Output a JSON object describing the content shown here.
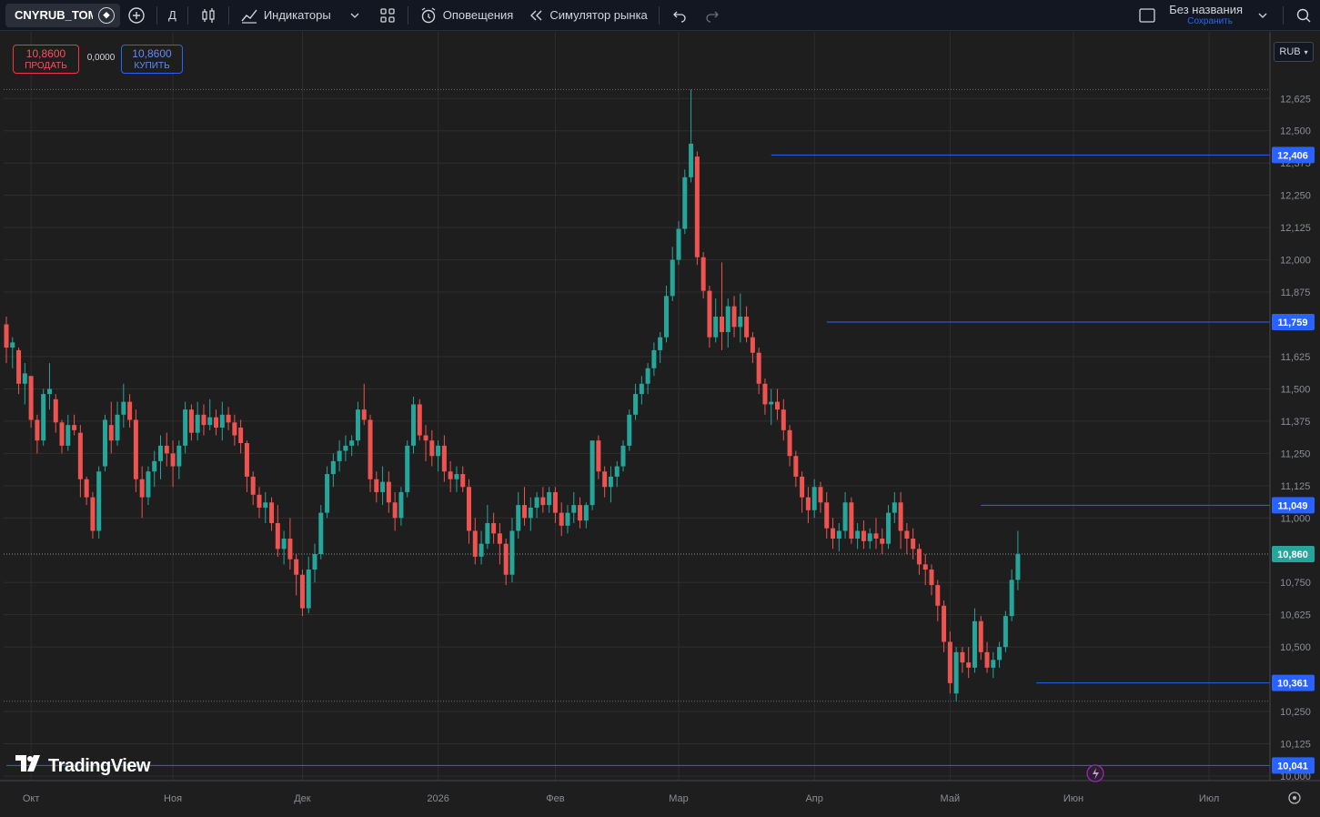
{
  "toolbar": {
    "symbol": "CNYRUB_TOM",
    "interval": "Д",
    "indicators_label": "Индикаторы",
    "alerts_label": "Оповещения",
    "replay_label": "Симулятор рынка",
    "layout_name": "Без названия",
    "layout_save": "Сохранить"
  },
  "trade": {
    "sell_price": "10,8600",
    "sell_label": "ПРОДАТЬ",
    "spread": "0,0000",
    "buy_price": "10,8600",
    "buy_label": "КУПИТЬ"
  },
  "currency": "RUB",
  "logo_text": "TradingView",
  "colors": {
    "up": "#26a69a",
    "down": "#ef5350",
    "hline": "#2962ff",
    "grid": "#2e2e2e",
    "background": "#1e1e1e"
  },
  "chart_data": {
    "type": "candlestick",
    "y_axis": {
      "min": 10.0,
      "max": 12.7,
      "ticks": [
        "12,625",
        "12,500",
        "12,375",
        "12,250",
        "12,125",
        "12,000",
        "11,875",
        "11,625",
        "11,500",
        "11,375",
        "11,250",
        "11,125",
        "11,000",
        "10,750",
        "10,625",
        "10,500",
        "10,250",
        "10,125",
        "10,000"
      ]
    },
    "x_axis": {
      "ticks": [
        {
          "label": "Окт",
          "index": 4
        },
        {
          "label": "Ноя",
          "index": 27
        },
        {
          "label": "Дек",
          "index": 48
        },
        {
          "label": "2026",
          "index": 70
        },
        {
          "label": "Фев",
          "index": 89
        },
        {
          "label": "Мар",
          "index": 109
        },
        {
          "label": "Апр",
          "index": 131
        },
        {
          "label": "Май",
          "index": 153
        },
        {
          "label": "Июн",
          "index": 173
        },
        {
          "label": "Июл",
          "index": 195
        }
      ]
    },
    "last_price": 10.86,
    "last_price_label": "10,860",
    "horizontal_lines": [
      {
        "value": 12.406,
        "label": "12,406",
        "start_index": 124
      },
      {
        "value": 11.759,
        "label": "11,759",
        "start_index": 133
      },
      {
        "value": 11.049,
        "label": "11,049",
        "start_index": 158
      },
      {
        "value": 10.361,
        "label": "10,361",
        "start_index": 167
      },
      {
        "value": 10.041,
        "label": "10,041",
        "start_index": 0
      }
    ],
    "high_dotted": 12.66,
    "low_dotted": 10.29,
    "candles": [
      [
        11.75,
        11.78,
        11.6,
        11.66
      ],
      [
        11.66,
        11.7,
        11.58,
        11.68
      ],
      [
        11.65,
        11.66,
        11.48,
        11.52
      ],
      [
        11.52,
        11.6,
        11.44,
        11.56
      ],
      [
        11.55,
        11.55,
        11.35,
        11.38
      ],
      [
        11.38,
        11.4,
        11.25,
        11.3
      ],
      [
        11.3,
        11.5,
        11.28,
        11.48
      ],
      [
        11.48,
        11.6,
        11.42,
        11.5
      ],
      [
        11.46,
        11.48,
        11.33,
        11.37
      ],
      [
        11.37,
        11.38,
        11.25,
        11.28
      ],
      [
        11.28,
        11.4,
        11.26,
        11.36
      ],
      [
        11.36,
        11.4,
        11.32,
        11.34
      ],
      [
        11.33,
        11.36,
        11.08,
        11.15
      ],
      [
        11.15,
        11.16,
        11.05,
        11.08
      ],
      [
        11.08,
        11.1,
        10.92,
        10.95
      ],
      [
        10.95,
        11.2,
        10.92,
        11.18
      ],
      [
        11.2,
        11.4,
        11.18,
        11.38
      ],
      [
        11.36,
        11.45,
        11.25,
        11.3
      ],
      [
        11.3,
        11.45,
        11.28,
        11.4
      ],
      [
        11.4,
        11.52,
        11.35,
        11.45
      ],
      [
        11.45,
        11.48,
        11.35,
        11.38
      ],
      [
        11.38,
        11.42,
        11.1,
        11.15
      ],
      [
        11.15,
        11.2,
        11.0,
        11.08
      ],
      [
        11.08,
        11.2,
        11.05,
        11.18
      ],
      [
        11.18,
        11.26,
        11.12,
        11.22
      ],
      [
        11.22,
        11.32,
        11.15,
        11.28
      ],
      [
        11.28,
        11.33,
        11.2,
        11.25
      ],
      [
        11.25,
        11.3,
        11.12,
        11.2
      ],
      [
        11.2,
        11.3,
        11.15,
        11.28
      ],
      [
        11.28,
        11.45,
        11.25,
        11.42
      ],
      [
        11.42,
        11.44,
        11.3,
        11.33
      ],
      [
        11.33,
        11.45,
        11.3,
        11.4
      ],
      [
        11.4,
        11.44,
        11.32,
        11.36
      ],
      [
        11.36,
        11.46,
        11.34,
        11.39
      ],
      [
        11.39,
        11.42,
        11.32,
        11.35
      ],
      [
        11.35,
        11.45,
        11.3,
        11.4
      ],
      [
        11.4,
        11.43,
        11.34,
        11.37
      ],
      [
        11.37,
        11.4,
        11.28,
        11.32
      ],
      [
        11.35,
        11.38,
        11.25,
        11.29
      ],
      [
        11.29,
        11.3,
        11.1,
        11.16
      ],
      [
        11.16,
        11.18,
        11.05,
        11.09
      ],
      [
        11.09,
        11.12,
        11.0,
        11.04
      ],
      [
        11.04,
        11.1,
        10.98,
        11.06
      ],
      [
        11.06,
        11.08,
        10.95,
        10.98
      ],
      [
        10.98,
        11.05,
        10.85,
        10.88
      ],
      [
        10.88,
        10.95,
        10.82,
        10.92
      ],
      [
        10.92,
        11.0,
        10.8,
        10.84
      ],
      [
        10.84,
        10.86,
        10.7,
        10.78
      ],
      [
        10.78,
        10.8,
        10.62,
        10.65
      ],
      [
        10.65,
        10.85,
        10.63,
        10.8
      ],
      [
        10.8,
        10.9,
        10.75,
        10.86
      ],
      [
        10.86,
        11.05,
        10.84,
        11.02
      ],
      [
        11.02,
        11.2,
        11.0,
        11.17
      ],
      [
        11.17,
        11.25,
        11.12,
        11.22
      ],
      [
        11.22,
        11.3,
        11.18,
        11.26
      ],
      [
        11.26,
        11.32,
        11.22,
        11.28
      ],
      [
        11.28,
        11.32,
        11.24,
        11.3
      ],
      [
        11.3,
        11.45,
        11.28,
        11.42
      ],
      [
        11.42,
        11.52,
        11.36,
        11.38
      ],
      [
        11.38,
        11.4,
        11.1,
        11.15
      ],
      [
        11.15,
        11.18,
        11.06,
        11.1
      ],
      [
        11.1,
        11.2,
        11.05,
        11.14
      ],
      [
        11.14,
        11.18,
        11.02,
        11.06
      ],
      [
        11.06,
        11.1,
        10.95,
        11.0
      ],
      [
        11.0,
        11.12,
        10.97,
        11.1
      ],
      [
        11.1,
        11.3,
        11.08,
        11.28
      ],
      [
        11.28,
        11.47,
        11.25,
        11.44
      ],
      [
        11.44,
        11.46,
        11.3,
        11.32
      ],
      [
        11.32,
        11.36,
        11.22,
        11.3
      ],
      [
        11.3,
        11.34,
        11.2,
        11.24
      ],
      [
        11.24,
        11.3,
        11.18,
        11.28
      ],
      [
        11.28,
        11.32,
        11.14,
        11.18
      ],
      [
        11.18,
        11.22,
        11.1,
        11.15
      ],
      [
        11.15,
        11.2,
        11.1,
        11.17
      ],
      [
        11.17,
        11.2,
        11.1,
        11.12
      ],
      [
        11.12,
        11.15,
        10.9,
        10.95
      ],
      [
        10.95,
        11.0,
        10.82,
        10.85
      ],
      [
        10.85,
        10.95,
        10.82,
        10.9
      ],
      [
        10.9,
        11.05,
        10.88,
        10.98
      ],
      [
        10.98,
        11.02,
        10.9,
        10.94
      ],
      [
        10.94,
        10.98,
        10.82,
        10.9
      ],
      [
        10.9,
        10.92,
        10.74,
        10.78
      ],
      [
        10.78,
        11.0,
        10.75,
        10.95
      ],
      [
        10.95,
        11.1,
        10.92,
        11.05
      ],
      [
        11.05,
        11.12,
        10.97,
        11.0
      ],
      [
        11.0,
        11.08,
        10.95,
        11.04
      ],
      [
        11.04,
        11.1,
        11.0,
        11.08
      ],
      [
        11.08,
        11.12,
        11.02,
        11.05
      ],
      [
        11.05,
        11.12,
        11.02,
        11.1
      ],
      [
        11.1,
        11.12,
        10.98,
        11.02
      ],
      [
        11.02,
        11.06,
        10.93,
        10.97
      ],
      [
        10.97,
        11.05,
        10.94,
        11.02
      ],
      [
        11.02,
        11.1,
        10.98,
        11.05
      ],
      [
        11.05,
        11.08,
        10.96,
        10.99
      ],
      [
        10.99,
        11.06,
        10.96,
        11.05
      ],
      [
        11.05,
        11.22,
        11.03,
        11.3
      ],
      [
        11.3,
        11.32,
        11.15,
        11.18
      ],
      [
        11.18,
        11.2,
        11.08,
        11.12
      ],
      [
        11.12,
        11.2,
        11.06,
        11.16
      ],
      [
        11.16,
        11.22,
        11.12,
        11.2
      ],
      [
        11.2,
        11.3,
        11.18,
        11.28
      ],
      [
        11.28,
        11.42,
        11.26,
        11.4
      ],
      [
        11.4,
        11.52,
        11.38,
        11.48
      ],
      [
        11.48,
        11.55,
        11.44,
        11.52
      ],
      [
        11.52,
        11.6,
        11.48,
        11.58
      ],
      [
        11.58,
        11.68,
        11.55,
        11.65
      ],
      [
        11.65,
        11.72,
        11.6,
        11.7
      ],
      [
        11.7,
        11.9,
        11.68,
        11.86
      ],
      [
        11.86,
        12.05,
        11.84,
        12.0
      ],
      [
        12.0,
        12.15,
        11.98,
        12.12
      ],
      [
        12.12,
        12.35,
        12.1,
        12.32
      ],
      [
        12.32,
        12.66,
        12.3,
        12.45
      ],
      [
        12.4,
        12.42,
        11.98,
        12.01
      ],
      [
        12.01,
        12.03,
        11.85,
        11.88
      ],
      [
        11.88,
        11.9,
        11.66,
        11.7
      ],
      [
        11.7,
        11.85,
        11.68,
        11.78
      ],
      [
        11.78,
        11.99,
        11.65,
        11.72
      ],
      [
        11.72,
        11.85,
        11.66,
        11.82
      ],
      [
        11.82,
        11.86,
        11.7,
        11.74
      ],
      [
        11.74,
        11.87,
        11.68,
        11.78
      ],
      [
        11.78,
        11.82,
        11.68,
        11.7
      ],
      [
        11.7,
        11.72,
        11.6,
        11.64
      ],
      [
        11.64,
        11.66,
        11.48,
        11.52
      ],
      [
        11.52,
        11.54,
        11.4,
        11.44
      ],
      [
        11.44,
        11.5,
        11.36,
        11.45
      ],
      [
        11.45,
        11.5,
        11.38,
        11.42
      ],
      [
        11.42,
        11.46,
        11.3,
        11.34
      ],
      [
        11.34,
        11.36,
        11.2,
        11.24
      ],
      [
        11.24,
        11.26,
        11.12,
        11.16
      ],
      [
        11.16,
        11.18,
        11.02,
        11.08
      ],
      [
        11.08,
        11.12,
        10.98,
        11.03
      ],
      [
        11.03,
        11.15,
        11.0,
        11.12
      ],
      [
        11.12,
        11.14,
        11.02,
        11.06
      ],
      [
        11.06,
        11.1,
        10.92,
        10.96
      ],
      [
        10.96,
        11.0,
        10.88,
        10.92
      ],
      [
        10.92,
        10.98,
        10.87,
        10.95
      ],
      [
        10.95,
        11.1,
        10.92,
        11.06
      ],
      [
        11.06,
        11.08,
        10.9,
        10.92
      ],
      [
        10.92,
        10.98,
        10.88,
        10.95
      ],
      [
        10.95,
        10.99,
        10.88,
        10.91
      ],
      [
        10.91,
        10.96,
        10.88,
        10.94
      ],
      [
        10.94,
        11.0,
        10.88,
        10.92
      ],
      [
        10.92,
        10.96,
        10.86,
        10.9
      ],
      [
        10.9,
        11.05,
        10.88,
        11.02
      ],
      [
        11.02,
        11.1,
        10.98,
        11.06
      ],
      [
        11.06,
        11.1,
        10.88,
        10.95
      ],
      [
        10.95,
        10.98,
        10.86,
        10.92
      ],
      [
        10.92,
        10.96,
        10.84,
        10.88
      ],
      [
        10.88,
        10.9,
        10.78,
        10.82
      ],
      [
        10.82,
        10.86,
        10.74,
        10.8
      ],
      [
        10.8,
        10.82,
        10.7,
        10.74
      ],
      [
        10.74,
        10.76,
        10.6,
        10.66
      ],
      [
        10.66,
        10.68,
        10.48,
        10.52
      ],
      [
        10.52,
        10.56,
        10.32,
        10.36
      ],
      [
        10.32,
        10.5,
        10.29,
        10.48
      ],
      [
        10.48,
        10.5,
        10.4,
        10.44
      ],
      [
        10.44,
        10.5,
        10.38,
        10.42
      ],
      [
        10.42,
        10.65,
        10.4,
        10.6
      ],
      [
        10.6,
        10.62,
        10.45,
        10.48
      ],
      [
        10.48,
        10.52,
        10.4,
        10.42
      ],
      [
        10.42,
        10.48,
        10.38,
        10.45
      ],
      [
        10.45,
        10.52,
        10.42,
        10.5
      ],
      [
        10.5,
        10.64,
        10.48,
        10.62
      ],
      [
        10.62,
        10.8,
        10.6,
        10.76
      ],
      [
        10.76,
        10.95,
        10.72,
        10.86
      ]
    ]
  }
}
